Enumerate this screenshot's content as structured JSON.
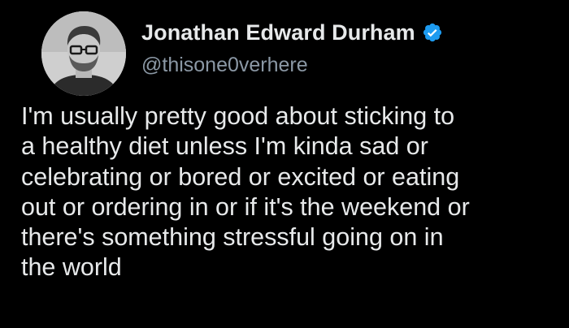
{
  "author": {
    "display_name": "Jonathan Edward Durham",
    "handle": "@thisone0verhere",
    "verified": true,
    "verified_color": "#1d9bf0"
  },
  "tweet": {
    "lines": [
      "I'm usually pretty good about sticking to",
      "a healthy diet unless I'm kinda sad or",
      "celebrating or bored or excited or eating",
      "out or ordering in or if it's the weekend or",
      "there's something stressful going on in",
      "the world"
    ]
  },
  "theme": {
    "background": "#000000",
    "text": "#e7e9ea",
    "secondary_text": "#8b98a5"
  }
}
